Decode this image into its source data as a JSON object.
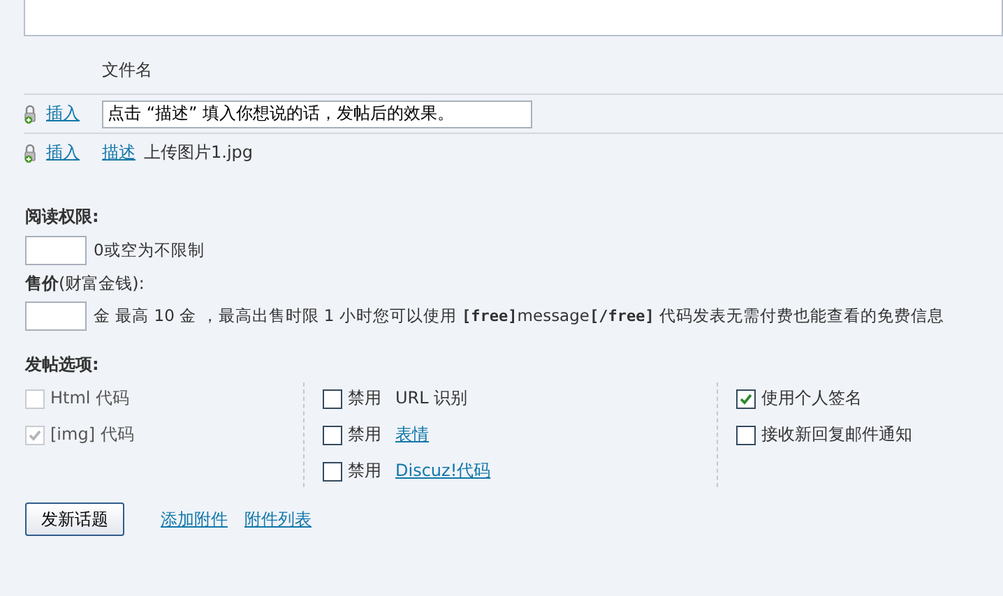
{
  "attachments": {
    "column_header": "文件名",
    "rows": [
      {
        "insert": "插入",
        "kind": "input",
        "value": "点击 “描述” 填入你想说的话，发帖后的效果。"
      },
      {
        "insert": "插入",
        "kind": "file",
        "describe": "描述",
        "filename": "上传图片1.jpg"
      }
    ]
  },
  "read_permission": {
    "label": "阅读权限:",
    "hint": "0或空为不限制"
  },
  "price": {
    "label": "售价",
    "note": "(财富金钱):",
    "hint": "金 最高 10 金 ，最高出售时限 1 小时您可以使用 **[free]**message**[/free]** 代码发表无需付费也能查看的免费信息"
  },
  "post_options": {
    "label": "发帖选项:",
    "columns": [
      [
        {
          "kind": "text",
          "label": "Html 代码",
          "checked": false,
          "disabled": true
        },
        {
          "kind": "text",
          "label": "[img] 代码",
          "checked": true,
          "disabled": true
        }
      ],
      [
        {
          "kind": "text",
          "prefix": "禁用",
          "label": "URL 识别",
          "checked": false,
          "disabled": false
        },
        {
          "kind": "link",
          "prefix": "禁用",
          "label": "表情",
          "checked": false,
          "disabled": false
        },
        {
          "kind": "link",
          "prefix": "禁用",
          "label": "Discuz!代码",
          "checked": false,
          "disabled": false
        }
      ],
      [
        {
          "kind": "text",
          "label": "使用个人签名",
          "checked": true,
          "disabled": false
        },
        {
          "kind": "text",
          "label": "接收新回复邮件通知",
          "checked": false,
          "disabled": false
        }
      ]
    ]
  },
  "submit": "发新话题",
  "links": [
    "添加附件",
    "附件列表"
  ]
}
